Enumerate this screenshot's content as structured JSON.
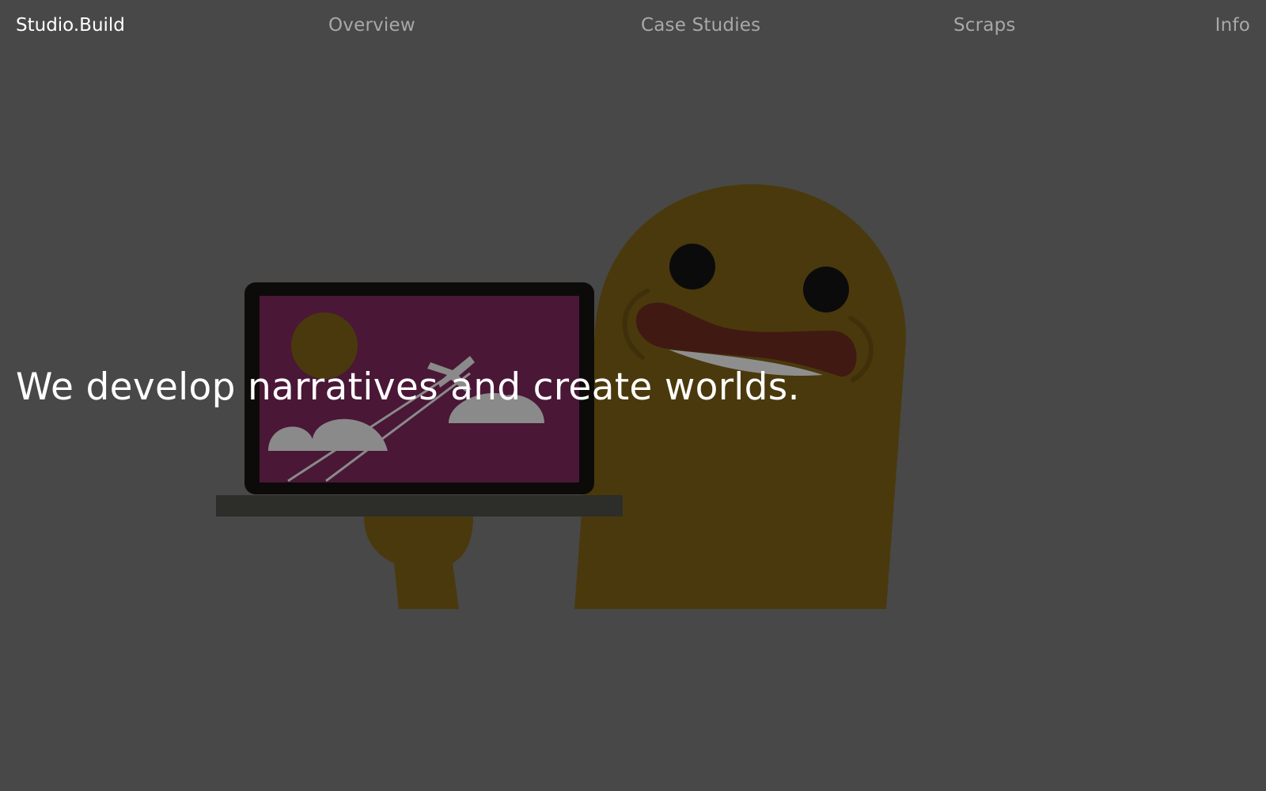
{
  "site": {
    "brand": "Studio.Build"
  },
  "nav": {
    "items": [
      {
        "label": "Overview"
      },
      {
        "label": "Case Studies"
      },
      {
        "label": "Scraps"
      },
      {
        "label": "Info"
      }
    ]
  },
  "hero": {
    "headline": "We develop narratives and create worlds.",
    "illustration": {
      "subject": "mustard-colored blob character with open mouth holding a laptop",
      "screen_content": "sun, clouds and airplane on magenta background"
    }
  },
  "colors": {
    "background": "#484848",
    "character": "#4a390c",
    "laptop_screen": "#4a1736",
    "laptop_frame": "#0c0b0a",
    "mouth": "#401a12",
    "headline_text": "#ffffff",
    "nav_text": "#a8a8a8"
  }
}
